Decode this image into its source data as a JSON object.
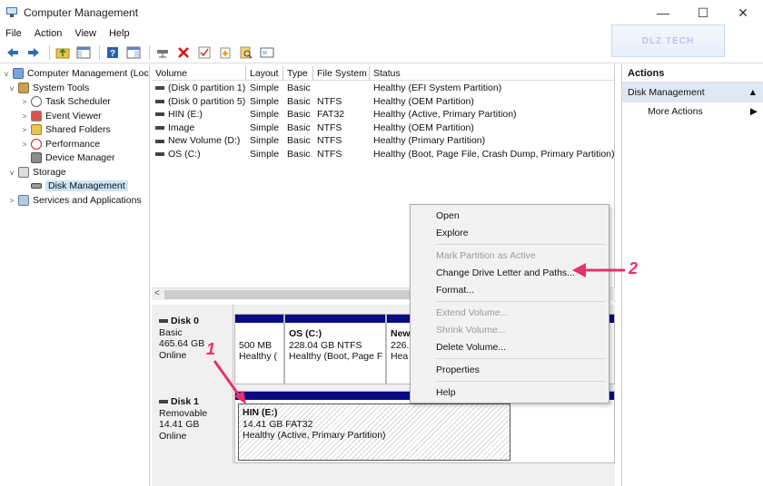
{
  "window": {
    "title": "Computer Management",
    "controls": [
      "—",
      "☐",
      "✕"
    ]
  },
  "watermark": "DLZ TECH",
  "menu": [
    "File",
    "Action",
    "View",
    "Help"
  ],
  "tree": [
    {
      "label": "Computer Management (Local",
      "icon": "computer-icon",
      "arrow": "v"
    },
    {
      "label": "System Tools",
      "icon": "tools-icon",
      "arrow": "v"
    },
    {
      "label": "Task Scheduler",
      "icon": "clock-icon",
      "arrow": ">"
    },
    {
      "label": "Event Viewer",
      "icon": "event-viewer-icon",
      "arrow": ">"
    },
    {
      "label": "Shared Folders",
      "icon": "shared-folder-icon",
      "arrow": ">"
    },
    {
      "label": "Performance",
      "icon": "performance-icon",
      "arrow": ">"
    },
    {
      "label": "Device Manager",
      "icon": "device-manager-icon",
      "arrow": ""
    },
    {
      "label": "Storage",
      "icon": "storage-icon",
      "arrow": "v"
    },
    {
      "label": "Disk Management",
      "icon": "disk-management-icon",
      "arrow": ""
    },
    {
      "label": "Services and Applications",
      "icon": "services-icon",
      "arrow": ">"
    }
  ],
  "volume_table": {
    "headers": [
      "Volume",
      "Layout",
      "Type",
      "File System",
      "Status"
    ],
    "rows": [
      [
        "(Disk 0 partition 1)",
        "Simple",
        "Basic",
        "",
        "Healthy (EFI System Partition)"
      ],
      [
        "(Disk 0 partition 5)",
        "Simple",
        "Basic",
        "NTFS",
        "Healthy (OEM Partition)"
      ],
      [
        "HIN (E:)",
        "Simple",
        "Basic",
        "FAT32",
        "Healthy (Active, Primary Partition)"
      ],
      [
        "Image",
        "Simple",
        "Basic",
        "NTFS",
        "Healthy (OEM Partition)"
      ],
      [
        "New Volume (D:)",
        "Simple",
        "Basic",
        "NTFS",
        "Healthy (Primary Partition)"
      ],
      [
        "OS (C:)",
        "Simple",
        "Basic",
        "NTFS",
        "Healthy (Boot, Page File, Crash Dump, Primary Partition)"
      ]
    ]
  },
  "disks": [
    {
      "name": "Disk 0",
      "type": "Basic",
      "size": "465.64 GB",
      "state": "Online",
      "partitions": [
        {
          "name": "",
          "line1": "500 MB",
          "line2": "Healthy ("
        },
        {
          "name": "OS  (C:)",
          "line1": "228.04 GB NTFS",
          "line2": "Healthy (Boot, Page F"
        },
        {
          "name": "New",
          "line1": "226.",
          "line2": "Hea"
        }
      ]
    },
    {
      "name": "Disk 1",
      "type": "Removable",
      "size": "14.41 GB",
      "state": "Online",
      "partitions": [
        {
          "name": "HIN  (E:)",
          "line1": "14.41 GB FAT32",
          "line2": "Healthy (Active, Primary Partition)"
        }
      ]
    }
  ],
  "actions": {
    "header": "Actions",
    "section": "Disk Management",
    "items": [
      "More Actions"
    ]
  },
  "context_menu": [
    {
      "label": "Open",
      "enabled": true
    },
    {
      "label": "Explore",
      "enabled": true
    },
    {
      "sep": true
    },
    {
      "label": "Mark Partition as Active",
      "enabled": false
    },
    {
      "label": "Change Drive Letter and Paths...",
      "enabled": true
    },
    {
      "label": "Format...",
      "enabled": true
    },
    {
      "sep": true
    },
    {
      "label": "Extend Volume...",
      "enabled": false
    },
    {
      "label": "Shrink Volume...",
      "enabled": false
    },
    {
      "label": "Delete Volume...",
      "enabled": true
    },
    {
      "sep": true
    },
    {
      "label": "Properties",
      "enabled": true
    },
    {
      "sep": true
    },
    {
      "label": "Help",
      "enabled": true
    }
  ],
  "annotations": [
    "1",
    "2"
  ],
  "colors": {
    "accent": "#e8316b",
    "partition_bar": "#0a0a84",
    "selection": "#cce4f7"
  }
}
